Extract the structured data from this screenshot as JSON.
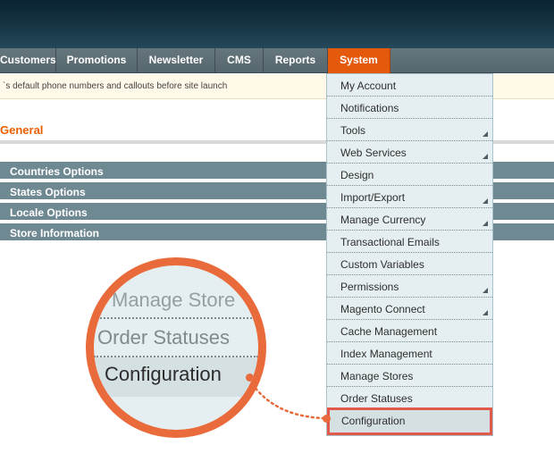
{
  "nav": {
    "items": [
      {
        "label": "Customers"
      },
      {
        "label": "Promotions"
      },
      {
        "label": "Newsletter"
      },
      {
        "label": "CMS"
      },
      {
        "label": "Reports"
      },
      {
        "label": "System"
      }
    ]
  },
  "notice": {
    "text": "`s default phone numbers and callouts before site launch"
  },
  "page": {
    "title": "General"
  },
  "sections": [
    {
      "label": "Countries Options"
    },
    {
      "label": "States Options"
    },
    {
      "label": "Locale Options"
    },
    {
      "label": "Store Information"
    }
  ],
  "system_menu": {
    "items": [
      {
        "label": "My Account",
        "has_submenu": false
      },
      {
        "label": "Notifications",
        "has_submenu": false
      },
      {
        "label": "Tools",
        "has_submenu": true
      },
      {
        "label": "Web Services",
        "has_submenu": true
      },
      {
        "label": "Design",
        "has_submenu": false
      },
      {
        "label": "Import/Export",
        "has_submenu": true
      },
      {
        "label": "Manage Currency",
        "has_submenu": true
      },
      {
        "label": "Transactional Emails",
        "has_submenu": false
      },
      {
        "label": "Custom Variables",
        "has_submenu": false
      },
      {
        "label": "Permissions",
        "has_submenu": true
      },
      {
        "label": "Magento Connect",
        "has_submenu": true
      },
      {
        "label": "Cache Management",
        "has_submenu": false
      },
      {
        "label": "Index Management",
        "has_submenu": false
      },
      {
        "label": "Manage Stores",
        "has_submenu": false
      },
      {
        "label": "Order Statuses",
        "has_submenu": false
      },
      {
        "label": "Configuration",
        "has_submenu": false,
        "highlighted": true
      }
    ]
  },
  "magnifier": {
    "items": [
      {
        "label": "Manage Store"
      },
      {
        "label": "Order Statuses"
      },
      {
        "label": "Configuration"
      }
    ]
  },
  "colors": {
    "nav_active": "#e5590d",
    "page_title": "#eb5e00",
    "section_bar": "#6f8992",
    "menu_bg": "#e5eef0",
    "highlight_border": "#e2584a",
    "callout": "#e96a3b"
  }
}
